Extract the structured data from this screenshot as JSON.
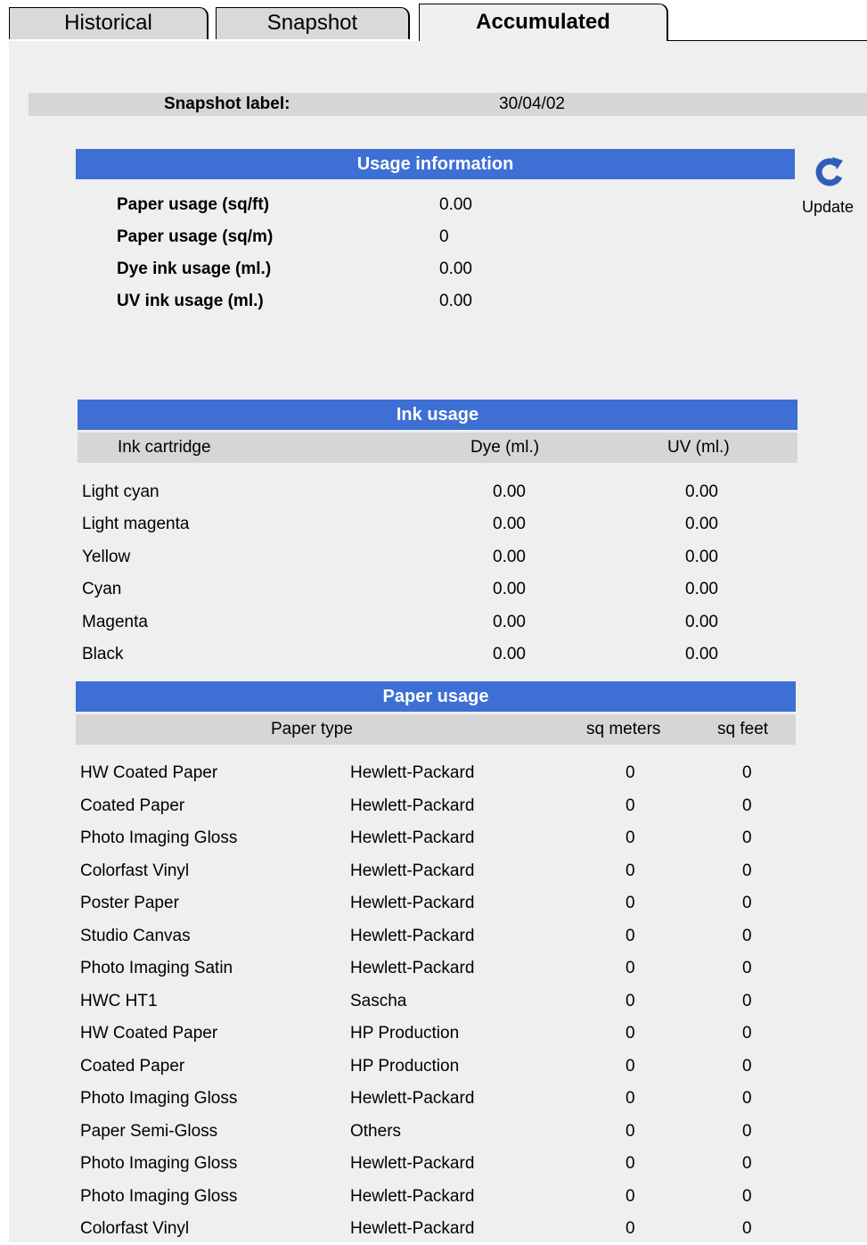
{
  "tabs": [
    {
      "label": "Historical",
      "active": false
    },
    {
      "label": "Snapshot",
      "active": false
    },
    {
      "label": "Accumulated",
      "active": true
    }
  ],
  "snapshot": {
    "label": "Snapshot label:",
    "value": "30/04/02"
  },
  "update_button": {
    "label": "Update",
    "icon": "refresh-icon"
  },
  "usage_info": {
    "title": "Usage information",
    "rows": [
      {
        "label": "Paper usage (sq/ft)",
        "value": "0.00"
      },
      {
        "label": "Paper usage (sq/m)",
        "value": "0"
      },
      {
        "label": "Dye ink usage (ml.)",
        "value": "0.00"
      },
      {
        "label": "UV ink usage (ml.)",
        "value": "0.00"
      }
    ]
  },
  "ink_usage": {
    "title": "Ink usage",
    "columns": [
      "Ink cartridge",
      "Dye (ml.)",
      "UV (ml.)"
    ],
    "rows": [
      {
        "name": "Light cyan",
        "dye": "0.00",
        "uv": "0.00"
      },
      {
        "name": "Light magenta",
        "dye": "0.00",
        "uv": "0.00"
      },
      {
        "name": "Yellow",
        "dye": "0.00",
        "uv": "0.00"
      },
      {
        "name": "Cyan",
        "dye": "0.00",
        "uv": "0.00"
      },
      {
        "name": "Magenta",
        "dye": "0.00",
        "uv": "0.00"
      },
      {
        "name": "Black",
        "dye": "0.00",
        "uv": "0.00"
      }
    ]
  },
  "paper_usage": {
    "title": "Paper usage",
    "columns": [
      "Paper type",
      "sq meters",
      "sq feet"
    ],
    "rows": [
      {
        "type": "HW Coated Paper",
        "vendor": "Hewlett-Packard",
        "sqm": "0",
        "sqft": "0"
      },
      {
        "type": "Coated Paper",
        "vendor": "Hewlett-Packard",
        "sqm": "0",
        "sqft": "0"
      },
      {
        "type": "Photo Imaging Gloss",
        "vendor": "Hewlett-Packard",
        "sqm": "0",
        "sqft": "0"
      },
      {
        "type": "Colorfast Vinyl",
        "vendor": "Hewlett-Packard",
        "sqm": "0",
        "sqft": "0"
      },
      {
        "type": "Poster Paper",
        "vendor": "Hewlett-Packard",
        "sqm": "0",
        "sqft": "0"
      },
      {
        "type": "Studio Canvas",
        "vendor": "Hewlett-Packard",
        "sqm": "0",
        "sqft": "0"
      },
      {
        "type": "Photo Imaging Satin",
        "vendor": "Hewlett-Packard",
        "sqm": "0",
        "sqft": "0"
      },
      {
        "type": "HWC HT1",
        "vendor": "Sascha",
        "sqm": "0",
        "sqft": "0"
      },
      {
        "type": "HW Coated Paper",
        "vendor": "HP Production",
        "sqm": "0",
        "sqft": "0"
      },
      {
        "type": "Coated Paper",
        "vendor": "HP Production",
        "sqm": "0",
        "sqft": "0"
      },
      {
        "type": "Photo Imaging Gloss",
        "vendor": "Hewlett-Packard",
        "sqm": "0",
        "sqft": "0"
      },
      {
        "type": "Paper Semi-Gloss",
        "vendor": "Others",
        "sqm": "0",
        "sqft": "0"
      },
      {
        "type": "Photo Imaging Gloss",
        "vendor": "Hewlett-Packard",
        "sqm": "0",
        "sqft": "0"
      },
      {
        "type": "Photo Imaging Gloss",
        "vendor": "Hewlett-Packard",
        "sqm": "0",
        "sqft": "0"
      },
      {
        "type": "Colorfast Vinyl",
        "vendor": "Hewlett-Packard",
        "sqm": "0",
        "sqft": "0"
      }
    ]
  },
  "colors": {
    "header_blue": "#3d6fd4",
    "subheader_gray": "#d6d6d6",
    "panel_bg": "#efefef",
    "icon_blue": "#2f5db8"
  }
}
